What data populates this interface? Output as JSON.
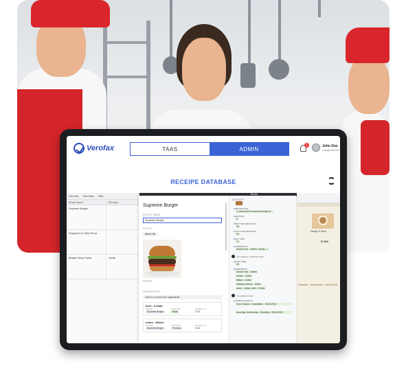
{
  "app": {
    "logo_text": "Verofax",
    "tabs": [
      {
        "label": "TAAS",
        "active": false
      },
      {
        "label": "ADMIN",
        "active": true
      }
    ],
    "notifications_count": "1",
    "user": {
      "name": "John Doe",
      "email": "hello@mail.com"
    },
    "page_title": "RECEIPE DATABASE",
    "accent_color": "#3b63d6"
  },
  "grid": {
    "toolbar": [
      "Grid view",
      "Hide fields",
      "Filter"
    ],
    "columns": [
      "Recipe Name",
      "Servings"
    ],
    "rows": [
      {
        "name": "Supreme Burger",
        "extra": ""
      },
      {
        "name": "Pepperoni & Olive Pizza",
        "extra": ""
      },
      {
        "name": "Bowtie Pesto Pasta",
        "extra": "Jovita"
      }
    ]
  },
  "record": {
    "title": "Supreme Burger",
    "name_label": "RECIPE NAME",
    "name_value": "Supreme Burger",
    "photo_label": "PHOTO",
    "attach_label": "Attach file",
    "image_caption": "burger.jpg",
    "ingredients_label": "INGREDIENTS",
    "link_label": "Link to a record from Ingredients",
    "ingredients": [
      {
        "name": "beef - 0.2lb/b",
        "recipe": "Supreme Burger",
        "type": "Meat",
        "qty": "0.25"
      },
      {
        "name": "onion - $/slice",
        "recipe": "Supreme Burger",
        "type": "Produce",
        "qty": "0.60"
      }
    ],
    "card_headers": [
      "RECIPE",
      "SUPPLIER",
      "RECIPE QTY"
    ]
  },
  "activity": {
    "header": "ACTIVITY",
    "entries": [
      {
        "label": "PREPARATION",
        "value": "1. place beef in bowl and shape fo..."
      },
      {
        "label": "SERVINGS",
        "value": "8"
      },
      {
        "label": "PREP TIME (MINUTES)",
        "value": "15"
      },
      {
        "label": "COOK TIME (MINUTES)",
        "value": "25"
      },
      {
        "label": "REST TIME",
        "value": "10"
      },
      {
        "label": "INGREDIENTS",
        "value": "brioche bun - 1beef1, tomato -..."
      },
      {
        "label": "You edited by matching a field",
        "value": ""
      },
      {
        "label": "SHORT TIME",
        "value": "45"
      },
      {
        "label": "INGREDIENTS",
        "value": "brioche bun - 1beef1"
      },
      {
        "label": "",
        "value": "tomato - 1/slice"
      },
      {
        "label": "",
        "value": "lettuce - 1/slice"
      },
      {
        "label": "",
        "value": "cheddar cheese - 1/slice"
      },
      {
        "label": "",
        "value": "onion - 1/slice, beef - 0.2lb/b"
      },
      {
        "label": "You added an item",
        "value": ""
      },
      {
        "label": "CATERING EVENTS",
        "value": "Farm Cuisine - Graduation - 05/10/2018"
      },
      {
        "label": "",
        "value": "Jennings: Anniversary - Wedding - 06/10/2018"
      }
    ]
  },
  "preview": {
    "blocks_label": "Blocks",
    "card_title": "Dough & Glory",
    "event": "Gonzalez - Anniversary - 06/10/2018",
    "amount": "$7,964"
  }
}
